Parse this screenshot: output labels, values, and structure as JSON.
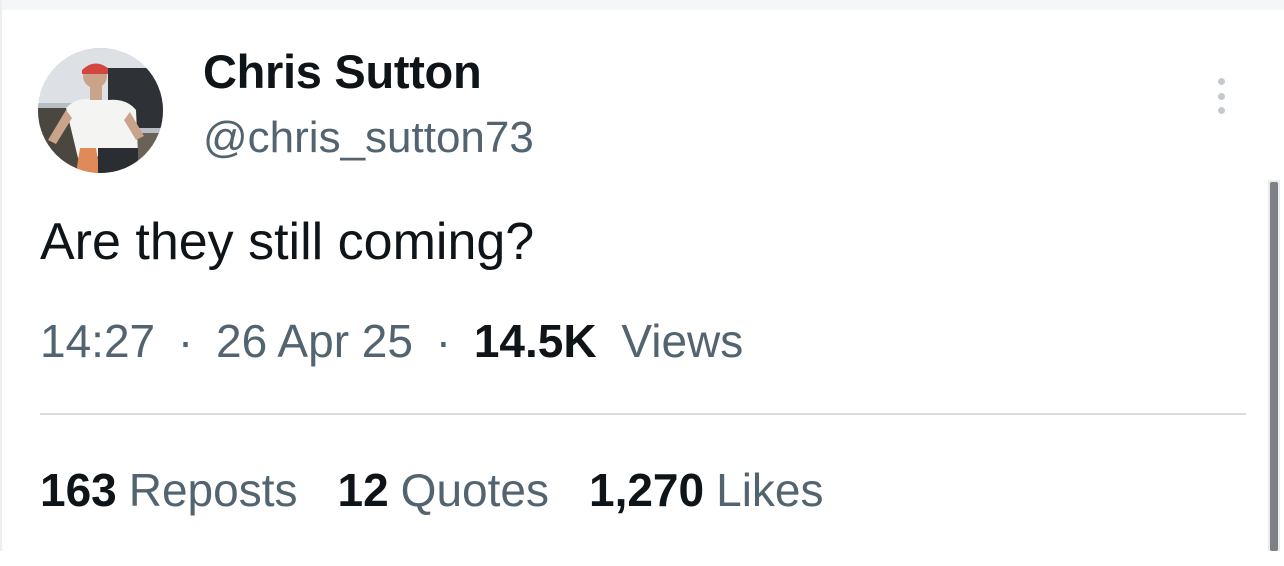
{
  "author": {
    "name": "Chris Sutton",
    "handle": "@chris_sutton73",
    "avatar_icon": "profile-photo"
  },
  "tweet": {
    "text": "Are they still coming?",
    "time": "14:27",
    "separator": "·",
    "date": "26 Apr 25",
    "views_count": "14.5K",
    "views_label": "Views"
  },
  "stats": [
    {
      "count": "163",
      "label": "Reposts"
    },
    {
      "count": "12",
      "label": "Quotes"
    },
    {
      "count": "1,270",
      "label": "Likes"
    }
  ],
  "colors": {
    "text_primary": "#0f1419",
    "text_secondary": "#536471",
    "divider": "#d9dde1"
  }
}
